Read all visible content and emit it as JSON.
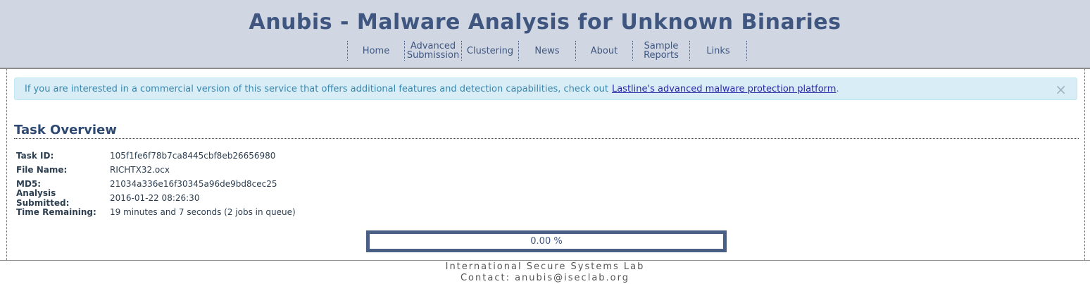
{
  "header": {
    "title": "Anubis - Malware Analysis for Unknown Binaries",
    "nav": [
      {
        "label": "Home"
      },
      {
        "label": "Advanced Submission"
      },
      {
        "label": "Clustering"
      },
      {
        "label": "News"
      },
      {
        "label": "About"
      },
      {
        "label": "Sample Reports"
      },
      {
        "label": "Links"
      }
    ]
  },
  "alert": {
    "text": "If you are interested in a commercial version of this service that offers additional features and detection capabilities, check out",
    "link_text": "Lastline's advanced malware protection platform",
    "suffix": ".",
    "close_symbol": "×"
  },
  "task": {
    "section_title": "Task Overview",
    "rows": [
      {
        "label": "Task ID:",
        "value": "105f1fe6f78b7ca8445cbf8eb26656980"
      },
      {
        "label": "File Name:",
        "value": "RICHTX32.ocx"
      },
      {
        "label": "MD5:",
        "value": "21034a336e16f30345a96de9bd8cec25"
      },
      {
        "label": "Analysis Submitted:",
        "value": "2016-01-22 08:26:30"
      },
      {
        "label": "Time Remaining:",
        "value": "19 minutes and 7 seconds (2 jobs in queue)"
      }
    ],
    "progress_text": "0.00 %",
    "progress_fraction": 0
  },
  "footer": {
    "lab": "International Secure Systems Lab",
    "contact_label": "Contact:",
    "contact_email": "anubis@iseclab.org"
  },
  "colors": {
    "header_bg": "#d0d7e2",
    "title": "#3f5680",
    "alert_bg": "#d9edf7",
    "progress_border": "#4a5f85"
  }
}
